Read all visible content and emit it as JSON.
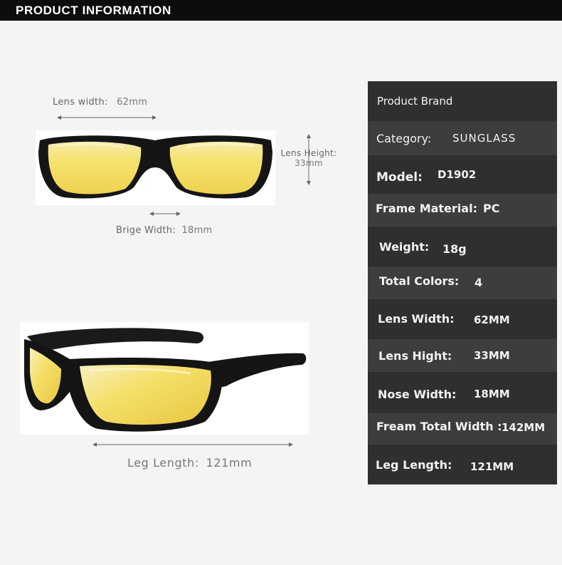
{
  "header": {
    "title": "PRODUCT INFORMATION"
  },
  "front_view": {
    "lens_width_label": "Lens width:",
    "lens_width_value": "62mm",
    "lens_height_label": "Lens Height:",
    "lens_height_value": "33mm",
    "bridge_width_label": "Brige Width:",
    "bridge_width_value": "18mm"
  },
  "side_view": {
    "leg_length_label": "Leg Length:",
    "leg_length_value": "121mm"
  },
  "spec_table": {
    "rows": [
      {
        "label": "Product Brand",
        "value": ""
      },
      {
        "label": "Category:",
        "value": "SUNGLASS"
      },
      {
        "label": "Model:",
        "value": "D1902"
      },
      {
        "label": "Frame Material:",
        "value": "PC"
      },
      {
        "label": "Weight:",
        "value": "18g"
      },
      {
        "label": "Total Colors:",
        "value": "4"
      },
      {
        "label": "Lens Width:",
        "value": "62MM"
      },
      {
        "label": "Lens Hight:",
        "value": "33MM"
      },
      {
        "label": "Nose Width:",
        "value": "18MM"
      },
      {
        "label": "Fream Total Width :",
        "value": "142MM"
      },
      {
        "label": "Leg Length:",
        "value": "121MM"
      }
    ]
  },
  "colors": {
    "header_bg": "#0d0d0d",
    "table_dark": "#2f2f2f",
    "table_light": "#3d3d3d",
    "lens_yellow": "#f3e27a",
    "frame_black": "#151515"
  }
}
